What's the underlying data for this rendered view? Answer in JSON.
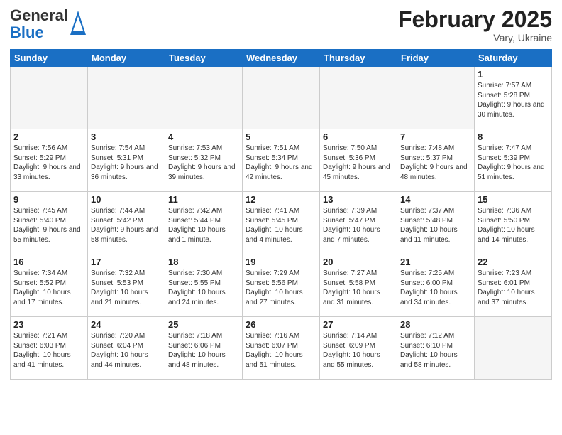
{
  "header": {
    "logo_general": "General",
    "logo_blue": "Blue",
    "month_title": "February 2025",
    "location": "Vary, Ukraine"
  },
  "weekdays": [
    "Sunday",
    "Monday",
    "Tuesday",
    "Wednesday",
    "Thursday",
    "Friday",
    "Saturday"
  ],
  "weeks": [
    [
      {
        "day": "",
        "info": ""
      },
      {
        "day": "",
        "info": ""
      },
      {
        "day": "",
        "info": ""
      },
      {
        "day": "",
        "info": ""
      },
      {
        "day": "",
        "info": ""
      },
      {
        "day": "",
        "info": ""
      },
      {
        "day": "1",
        "info": "Sunrise: 7:57 AM\nSunset: 5:28 PM\nDaylight: 9 hours and 30 minutes."
      }
    ],
    [
      {
        "day": "2",
        "info": "Sunrise: 7:56 AM\nSunset: 5:29 PM\nDaylight: 9 hours and 33 minutes."
      },
      {
        "day": "3",
        "info": "Sunrise: 7:54 AM\nSunset: 5:31 PM\nDaylight: 9 hours and 36 minutes."
      },
      {
        "day": "4",
        "info": "Sunrise: 7:53 AM\nSunset: 5:32 PM\nDaylight: 9 hours and 39 minutes."
      },
      {
        "day": "5",
        "info": "Sunrise: 7:51 AM\nSunset: 5:34 PM\nDaylight: 9 hours and 42 minutes."
      },
      {
        "day": "6",
        "info": "Sunrise: 7:50 AM\nSunset: 5:36 PM\nDaylight: 9 hours and 45 minutes."
      },
      {
        "day": "7",
        "info": "Sunrise: 7:48 AM\nSunset: 5:37 PM\nDaylight: 9 hours and 48 minutes."
      },
      {
        "day": "8",
        "info": "Sunrise: 7:47 AM\nSunset: 5:39 PM\nDaylight: 9 hours and 51 minutes."
      }
    ],
    [
      {
        "day": "9",
        "info": "Sunrise: 7:45 AM\nSunset: 5:40 PM\nDaylight: 9 hours and 55 minutes."
      },
      {
        "day": "10",
        "info": "Sunrise: 7:44 AM\nSunset: 5:42 PM\nDaylight: 9 hours and 58 minutes."
      },
      {
        "day": "11",
        "info": "Sunrise: 7:42 AM\nSunset: 5:44 PM\nDaylight: 10 hours and 1 minute."
      },
      {
        "day": "12",
        "info": "Sunrise: 7:41 AM\nSunset: 5:45 PM\nDaylight: 10 hours and 4 minutes."
      },
      {
        "day": "13",
        "info": "Sunrise: 7:39 AM\nSunset: 5:47 PM\nDaylight: 10 hours and 7 minutes."
      },
      {
        "day": "14",
        "info": "Sunrise: 7:37 AM\nSunset: 5:48 PM\nDaylight: 10 hours and 11 minutes."
      },
      {
        "day": "15",
        "info": "Sunrise: 7:36 AM\nSunset: 5:50 PM\nDaylight: 10 hours and 14 minutes."
      }
    ],
    [
      {
        "day": "16",
        "info": "Sunrise: 7:34 AM\nSunset: 5:52 PM\nDaylight: 10 hours and 17 minutes."
      },
      {
        "day": "17",
        "info": "Sunrise: 7:32 AM\nSunset: 5:53 PM\nDaylight: 10 hours and 21 minutes."
      },
      {
        "day": "18",
        "info": "Sunrise: 7:30 AM\nSunset: 5:55 PM\nDaylight: 10 hours and 24 minutes."
      },
      {
        "day": "19",
        "info": "Sunrise: 7:29 AM\nSunset: 5:56 PM\nDaylight: 10 hours and 27 minutes."
      },
      {
        "day": "20",
        "info": "Sunrise: 7:27 AM\nSunset: 5:58 PM\nDaylight: 10 hours and 31 minutes."
      },
      {
        "day": "21",
        "info": "Sunrise: 7:25 AM\nSunset: 6:00 PM\nDaylight: 10 hours and 34 minutes."
      },
      {
        "day": "22",
        "info": "Sunrise: 7:23 AM\nSunset: 6:01 PM\nDaylight: 10 hours and 37 minutes."
      }
    ],
    [
      {
        "day": "23",
        "info": "Sunrise: 7:21 AM\nSunset: 6:03 PM\nDaylight: 10 hours and 41 minutes."
      },
      {
        "day": "24",
        "info": "Sunrise: 7:20 AM\nSunset: 6:04 PM\nDaylight: 10 hours and 44 minutes."
      },
      {
        "day": "25",
        "info": "Sunrise: 7:18 AM\nSunset: 6:06 PM\nDaylight: 10 hours and 48 minutes."
      },
      {
        "day": "26",
        "info": "Sunrise: 7:16 AM\nSunset: 6:07 PM\nDaylight: 10 hours and 51 minutes."
      },
      {
        "day": "27",
        "info": "Sunrise: 7:14 AM\nSunset: 6:09 PM\nDaylight: 10 hours and 55 minutes."
      },
      {
        "day": "28",
        "info": "Sunrise: 7:12 AM\nSunset: 6:10 PM\nDaylight: 10 hours and 58 minutes."
      },
      {
        "day": "",
        "info": ""
      }
    ]
  ]
}
